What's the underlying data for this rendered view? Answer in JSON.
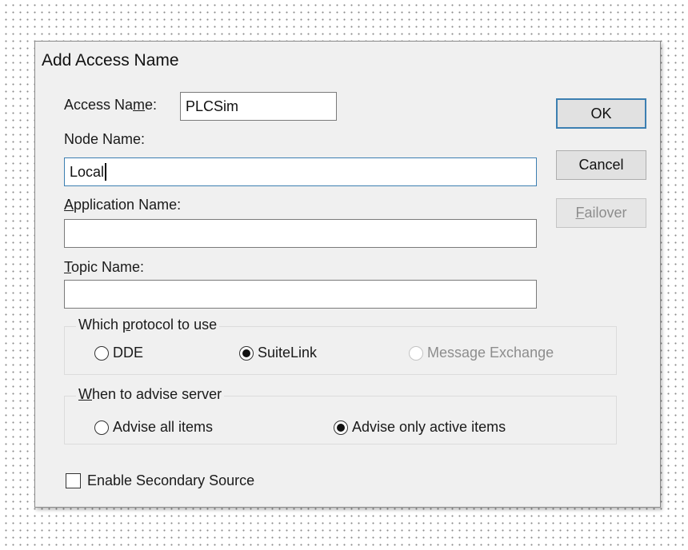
{
  "dialog": {
    "title": "Add Access Name",
    "access_name": {
      "label_pre": "Access Na",
      "label_u": "m",
      "label_post": "e:",
      "value": "PLCSim"
    },
    "node_name": {
      "label": "Node Name:",
      "value": "Local"
    },
    "application_name": {
      "label_u": "A",
      "label_rest": "pplication Name:",
      "value": ""
    },
    "topic_name": {
      "label_u": "T",
      "label_rest": "opic Name:",
      "value": ""
    },
    "buttons": {
      "ok": "OK",
      "cancel": "Cancel",
      "failover_u": "F",
      "failover_rest": "ailover",
      "failover_enabled": false
    },
    "protocol_group": {
      "title_pre": "Which ",
      "title_u": "p",
      "title_post": "rotocol to use",
      "options": [
        {
          "label": "DDE",
          "selected": false,
          "enabled": true
        },
        {
          "label": "SuiteLink",
          "selected": true,
          "enabled": true
        },
        {
          "label": "Message Exchange",
          "selected": false,
          "enabled": false
        }
      ]
    },
    "advise_group": {
      "title_u": "W",
      "title_rest": "hen to advise server",
      "options": [
        {
          "label": "Advise all items",
          "selected": false
        },
        {
          "label": "Advise only active items",
          "selected": true
        }
      ]
    },
    "secondary_source": {
      "label": "Enable Secondary Source",
      "checked": false
    }
  }
}
